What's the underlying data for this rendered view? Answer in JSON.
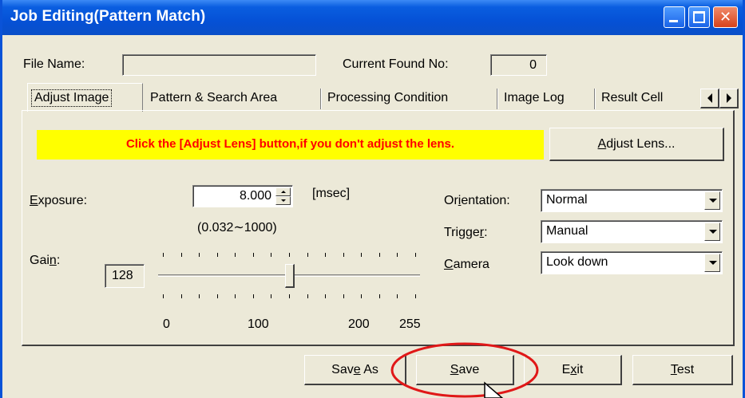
{
  "window": {
    "title": "Job Editing(Pattern Match)",
    "accent_color": "#0a5ee0"
  },
  "header": {
    "file_name_label": "File Name:",
    "file_name_value": "",
    "current_found_label": "Current Found No:",
    "current_found_value": "0"
  },
  "tabs": [
    {
      "label": "Adjust Image",
      "active": true
    },
    {
      "label": "Pattern & Search Area",
      "active": false
    },
    {
      "label": "Processing Condition",
      "active": false
    },
    {
      "label": "Image Log",
      "active": false
    },
    {
      "label": "Result Cell",
      "active": false
    }
  ],
  "adjust_image": {
    "notice": "Click the [Adjust Lens] button,if you don't adjust the lens.",
    "notice_color": "#ff0000",
    "notice_bg": "#ffff00",
    "adjust_lens_button": "Adjust Lens...",
    "exposure_label": "Exposure:",
    "exposure_value": "8.000",
    "exposure_unit": "[msec]",
    "exposure_range": "(0.032∼1000)",
    "gain_label": "Gain:",
    "gain_value": "128",
    "gain_fraction": 0.502,
    "slider_ticks": [
      "0",
      "100",
      "200",
      "255"
    ],
    "orientation_label": "Orientation:",
    "orientation_value": "Normal",
    "trigger_label": "Trigger:",
    "trigger_value": "Manual",
    "camera_label": "Camera",
    "camera_value": "Look down"
  },
  "footer": {
    "save_as": "Save As",
    "save": "Save",
    "exit": "Exit",
    "test": "Test"
  },
  "icons": {
    "minimize": "minimize-icon",
    "maximize": "maximize-icon",
    "close": "close-icon",
    "tab_scroll_left": "triangle-left-icon",
    "tab_scroll_right": "triangle-right-icon"
  }
}
